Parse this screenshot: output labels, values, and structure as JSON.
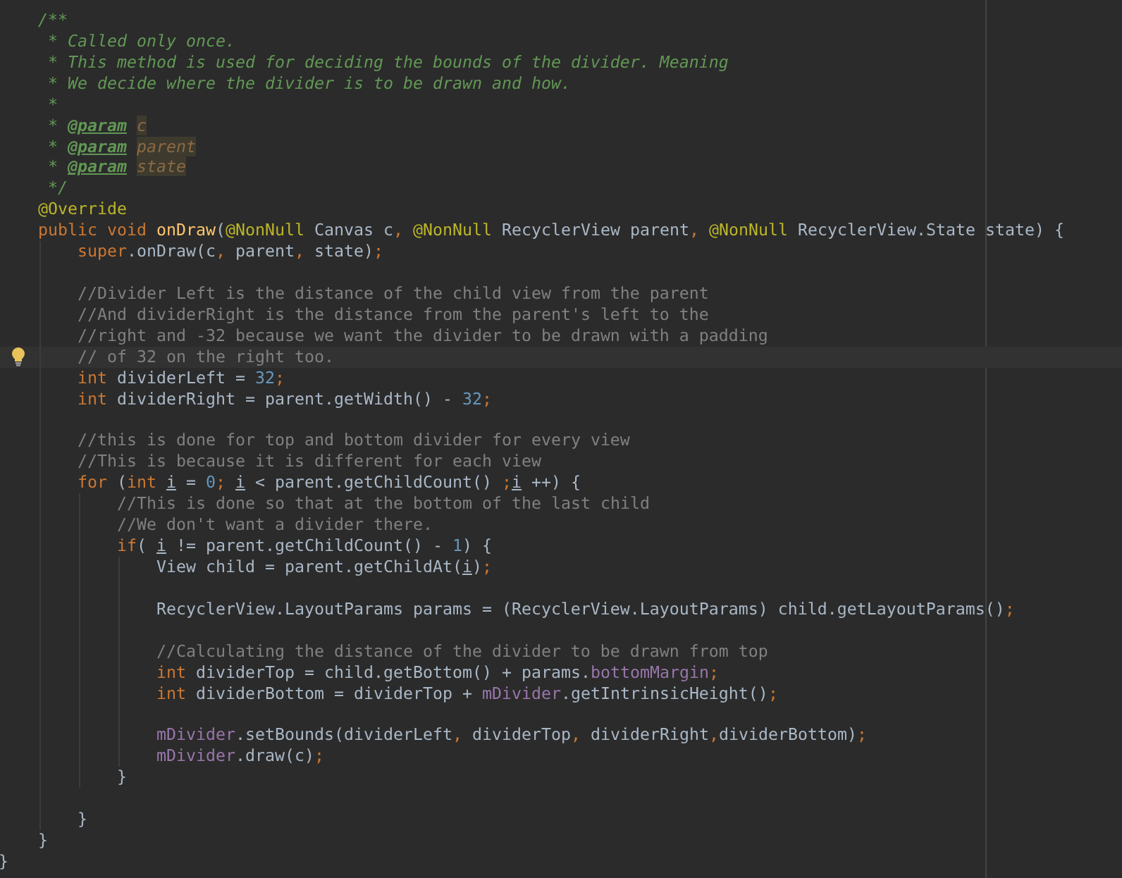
{
  "editor": {
    "lines": [
      {
        "current": false,
        "tokens": [
          {
            "kind": "doc",
            "text": "    /**"
          }
        ]
      },
      {
        "current": false,
        "tokens": [
          {
            "kind": "doc",
            "text": "     * Called only once."
          }
        ]
      },
      {
        "current": false,
        "tokens": [
          {
            "kind": "doc",
            "text": "     * This method is used for deciding the bounds of the divider. Meaning"
          }
        ]
      },
      {
        "current": false,
        "tokens": [
          {
            "kind": "doc",
            "text": "     * We decide where the divider is to be drawn and how."
          }
        ]
      },
      {
        "current": false,
        "tokens": [
          {
            "kind": "doc",
            "text": "     *"
          }
        ]
      },
      {
        "current": false,
        "tokens": [
          {
            "kind": "doc",
            "text": "     * "
          },
          {
            "kind": "doc_tag",
            "text": "@param"
          },
          {
            "kind": "doc_param",
            "text": " c"
          }
        ]
      },
      {
        "current": false,
        "tokens": [
          {
            "kind": "doc",
            "text": "     * "
          },
          {
            "kind": "doc_tag",
            "text": "@param"
          },
          {
            "kind": "doc_param",
            "text": " parent"
          }
        ]
      },
      {
        "current": false,
        "tokens": [
          {
            "kind": "doc",
            "text": "     * "
          },
          {
            "kind": "doc_tag",
            "text": "@param"
          },
          {
            "kind": "doc_param",
            "text": " state"
          }
        ]
      },
      {
        "current": false,
        "tokens": [
          {
            "kind": "doc",
            "text": "     */"
          }
        ]
      },
      {
        "current": false,
        "tokens": [
          {
            "kind": "annotation",
            "text": "    @Override"
          }
        ]
      },
      {
        "current": false,
        "tokens": [
          {
            "kind": "keyword",
            "text": "    public void "
          },
          {
            "kind": "method",
            "text": "onDraw"
          },
          {
            "kind": "plain",
            "text": "("
          },
          {
            "kind": "annotation",
            "text": "@NonNull"
          },
          {
            "kind": "plain",
            "text": " Canvas c"
          },
          {
            "kind": "punct",
            "text": ","
          },
          {
            "kind": "annotation",
            "text": " @NonNull"
          },
          {
            "kind": "plain",
            "text": " RecyclerView parent"
          },
          {
            "kind": "punct",
            "text": ","
          },
          {
            "kind": "annotation",
            "text": " @NonNull"
          },
          {
            "kind": "plain",
            "text": " RecyclerView.State state) {"
          }
        ]
      },
      {
        "current": false,
        "tokens": [
          {
            "kind": "keyword",
            "text": "        super"
          },
          {
            "kind": "plain",
            "text": ".onDraw(c"
          },
          {
            "kind": "punct",
            "text": ","
          },
          {
            "kind": "plain",
            "text": " parent"
          },
          {
            "kind": "punct",
            "text": ","
          },
          {
            "kind": "plain",
            "text": " state)"
          },
          {
            "kind": "punct",
            "text": ";"
          }
        ]
      },
      {
        "current": false
      },
      {
        "current": false,
        "tokens": [
          {
            "kind": "comment",
            "text": "        //Divider Left is the distance of the child view from the parent"
          }
        ]
      },
      {
        "current": false,
        "tokens": [
          {
            "kind": "comment",
            "text": "        //And dividerRight is the distance from the parent's left to the"
          }
        ]
      },
      {
        "current": false,
        "tokens": [
          {
            "kind": "comment",
            "text": "        //right and -32 because we want the divider to be drawn with a padding"
          }
        ]
      },
      {
        "current": true,
        "tokens": [
          {
            "kind": "comment",
            "text": "        // of 32 on the right too."
          }
        ]
      },
      {
        "current": false,
        "tokens": [
          {
            "kind": "keyword",
            "text": "        int "
          },
          {
            "kind": "plain",
            "text": "dividerLeft = "
          },
          {
            "kind": "number",
            "text": "32"
          },
          {
            "kind": "punct",
            "text": ";"
          }
        ]
      },
      {
        "current": false,
        "tokens": [
          {
            "kind": "keyword",
            "text": "        int "
          },
          {
            "kind": "plain",
            "text": "dividerRight = parent.getWidth() - "
          },
          {
            "kind": "number",
            "text": "32"
          },
          {
            "kind": "punct",
            "text": ";"
          }
        ]
      },
      {
        "current": false
      },
      {
        "current": false,
        "tokens": [
          {
            "kind": "comment",
            "text": "        //this is done for top and bottom divider for every view"
          }
        ]
      },
      {
        "current": false,
        "tokens": [
          {
            "kind": "comment",
            "text": "        //This is because it is different for each view"
          }
        ]
      },
      {
        "current": false,
        "tokens": [
          {
            "kind": "keyword",
            "text": "        for "
          },
          {
            "kind": "plain",
            "text": "("
          },
          {
            "kind": "keyword",
            "text": "int "
          },
          {
            "kind": "local_var",
            "text": "i"
          },
          {
            "kind": "plain",
            "text": " = "
          },
          {
            "kind": "number",
            "text": "0"
          },
          {
            "kind": "punct",
            "text": ";"
          },
          {
            "kind": "local_var",
            "text": " i"
          },
          {
            "kind": "plain",
            "text": " < parent.getChildCount() "
          },
          {
            "kind": "punct",
            "text": ";"
          },
          {
            "kind": "local_var",
            "text": "i"
          },
          {
            "kind": "plain",
            "text": " ++) {"
          }
        ]
      },
      {
        "current": false,
        "tokens": [
          {
            "kind": "comment",
            "text": "            //This is done so that at the bottom of the last child"
          }
        ]
      },
      {
        "current": false,
        "tokens": [
          {
            "kind": "comment",
            "text": "            //We don't want a divider there."
          }
        ]
      },
      {
        "current": false,
        "tokens": [
          {
            "kind": "keyword",
            "text": "            if"
          },
          {
            "kind": "plain",
            "text": "("
          },
          {
            "kind": "local_var",
            "text": " i"
          },
          {
            "kind": "plain",
            "text": " != parent.getChildCount() - "
          },
          {
            "kind": "number",
            "text": "1"
          },
          {
            "kind": "plain",
            "text": ") {"
          }
        ]
      },
      {
        "current": false,
        "tokens": [
          {
            "kind": "plain",
            "text": "                View child = parent.getChildAt("
          },
          {
            "kind": "local_var",
            "text": "i"
          },
          {
            "kind": "plain",
            "text": ")"
          },
          {
            "kind": "punct",
            "text": ";"
          }
        ]
      },
      {
        "current": false
      },
      {
        "current": false,
        "tokens": [
          {
            "kind": "plain",
            "text": "                RecyclerView.LayoutParams params = (RecyclerView.LayoutParams) child.getLayoutParams()"
          },
          {
            "kind": "punct",
            "text": ";"
          }
        ]
      },
      {
        "current": false
      },
      {
        "current": false,
        "tokens": [
          {
            "kind": "comment",
            "text": "                //Calculating the distance of the divider to be drawn from top"
          }
        ]
      },
      {
        "current": false,
        "tokens": [
          {
            "kind": "keyword",
            "text": "                int "
          },
          {
            "kind": "plain",
            "text": "dividerTop = child.getBottom() + params."
          },
          {
            "kind": "field",
            "text": "bottomMargin"
          },
          {
            "kind": "punct",
            "text": ";"
          }
        ]
      },
      {
        "current": false,
        "tokens": [
          {
            "kind": "keyword",
            "text": "                int "
          },
          {
            "kind": "plain",
            "text": "dividerBottom = dividerTop + "
          },
          {
            "kind": "field",
            "text": "mDivider"
          },
          {
            "kind": "plain",
            "text": ".getIntrinsicHeight()"
          },
          {
            "kind": "punct",
            "text": ";"
          }
        ]
      },
      {
        "current": false
      },
      {
        "current": false,
        "tokens": [
          {
            "kind": "field",
            "text": "                mDivider"
          },
          {
            "kind": "plain",
            "text": ".setBounds(dividerLeft"
          },
          {
            "kind": "punct",
            "text": ","
          },
          {
            "kind": "plain",
            "text": " dividerTop"
          },
          {
            "kind": "punct",
            "text": ","
          },
          {
            "kind": "plain",
            "text": " dividerRight"
          },
          {
            "kind": "punct",
            "text": ","
          },
          {
            "kind": "plain",
            "text": "dividerBottom)"
          },
          {
            "kind": "punct",
            "text": ";"
          }
        ]
      },
      {
        "current": false,
        "tokens": [
          {
            "kind": "field",
            "text": "                mDivider"
          },
          {
            "kind": "plain",
            "text": ".draw(c)"
          },
          {
            "kind": "punct",
            "text": ";"
          }
        ]
      },
      {
        "current": false,
        "tokens": [
          {
            "kind": "plain",
            "text": "            }"
          }
        ]
      },
      {
        "current": false
      },
      {
        "current": false,
        "tokens": [
          {
            "kind": "plain",
            "text": "        }"
          }
        ]
      },
      {
        "current": false,
        "tokens": [
          {
            "kind": "plain",
            "text": "    }"
          }
        ]
      },
      {
        "current": false,
        "tokens": [
          {
            "kind": "plain",
            "text": "}"
          }
        ]
      }
    ]
  }
}
